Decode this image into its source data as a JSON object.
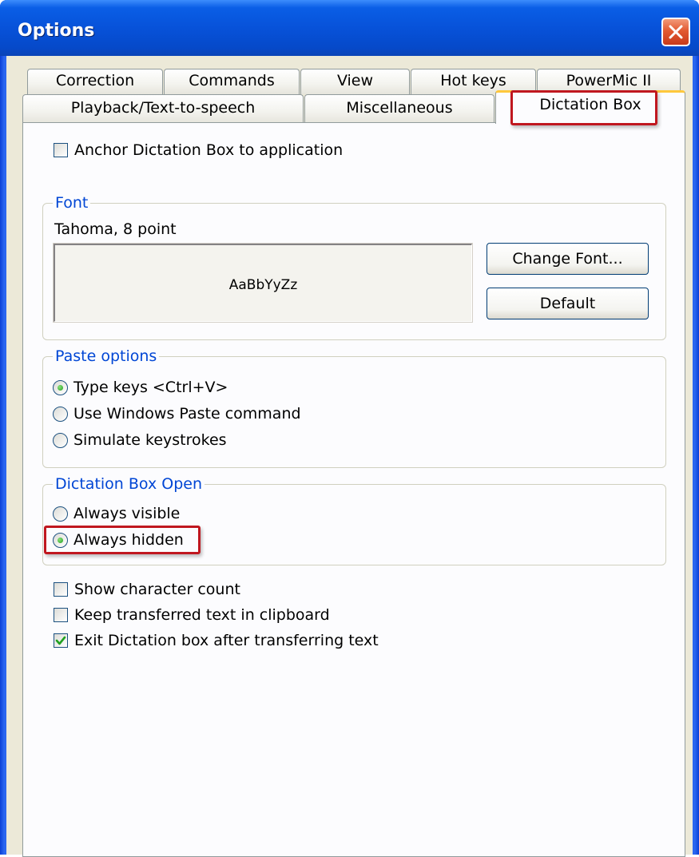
{
  "window": {
    "title": "Options"
  },
  "tabs_back_row": [
    {
      "label": "Correction"
    },
    {
      "label": "Commands"
    },
    {
      "label": "View"
    },
    {
      "label": "Hot keys"
    },
    {
      "label": "PowerMic II"
    }
  ],
  "tabs_front_row": [
    {
      "label": "Playback/Text-to-speech"
    },
    {
      "label": "Miscellaneous"
    },
    {
      "label": "Dictation Box",
      "selected": true
    }
  ],
  "anchor_checkbox": {
    "label": "Anchor Dictation Box to application",
    "checked": false
  },
  "font_group": {
    "legend": "Font",
    "current_font": "Tahoma, 8 point",
    "preview_text": "AaBbYyZz",
    "change_font_label": "Change Font...",
    "default_label": "Default"
  },
  "paste_group": {
    "legend": "Paste options",
    "options": [
      {
        "label": "Type keys <Ctrl+V>",
        "selected": true
      },
      {
        "label": "Use Windows Paste command",
        "selected": false
      },
      {
        "label": "Simulate keystrokes",
        "selected": false
      }
    ]
  },
  "open_group": {
    "legend": "Dictation Box Open",
    "options": [
      {
        "label": "Always visible",
        "selected": false
      },
      {
        "label": "Always hidden",
        "selected": true
      }
    ]
  },
  "checkboxes": [
    {
      "label": "Show character count",
      "checked": false
    },
    {
      "label": "Keep transferred text in clipboard",
      "checked": false
    },
    {
      "label": "Exit Dictation box after transferring text",
      "checked": true
    }
  ],
  "colors": {
    "title_bar": "#0752d9",
    "group_legend": "#0046d5",
    "highlight_box": "#c0171f",
    "active_tab_accent": "#ffc83c"
  }
}
